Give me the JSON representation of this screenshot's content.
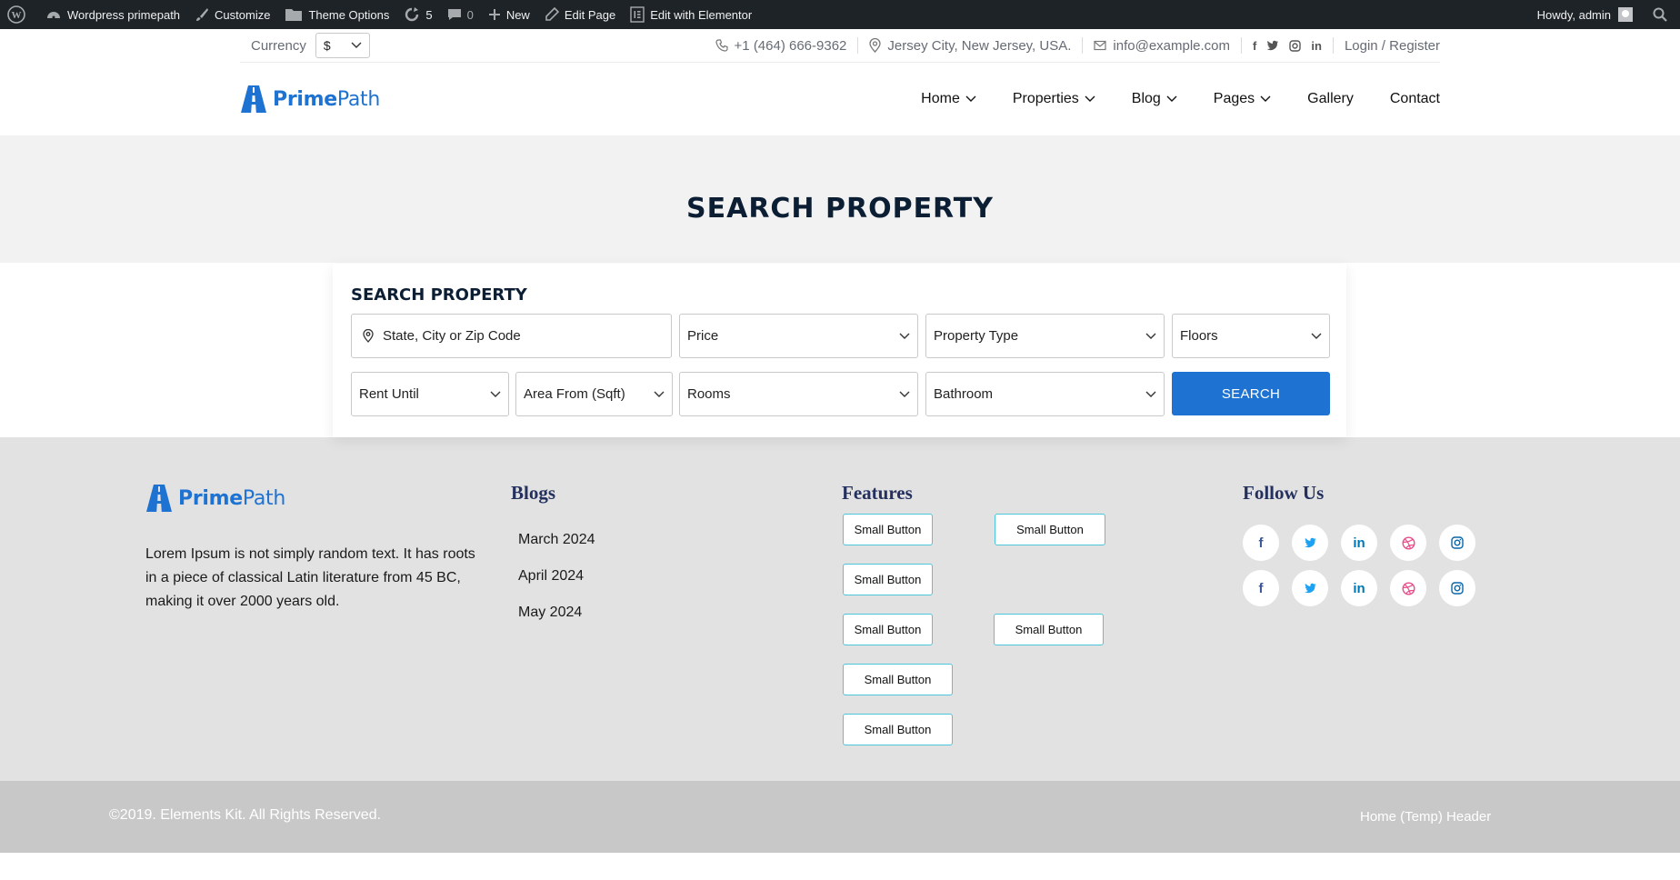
{
  "adminbar": {
    "site_name": "Wordpress primepath",
    "customize": "Customize",
    "theme_options": "Theme Options",
    "updates_count": "5",
    "comments_count": "0",
    "new": "New",
    "edit_page": "Edit Page",
    "edit_elementor": "Edit with Elementor",
    "howdy": "Howdy, admin"
  },
  "topbar": {
    "currency_label": "Currency",
    "currency_value": "$",
    "phone": "+1 (464) 666-9362",
    "location": "Jersey City, New Jersey, USA.",
    "email": "info@example.com",
    "login": "Login / Register"
  },
  "logo": {
    "bold": "Prime",
    "light": "Path"
  },
  "nav": [
    {
      "label": "Home",
      "dropdown": true
    },
    {
      "label": "Properties",
      "dropdown": true
    },
    {
      "label": "Blog",
      "dropdown": true
    },
    {
      "label": "Pages",
      "dropdown": true
    },
    {
      "label": "Gallery",
      "dropdown": false
    },
    {
      "label": "Contact",
      "dropdown": false
    }
  ],
  "banner": {
    "title": "SEARCH PROPERTY"
  },
  "search": {
    "title": "SEARCH PROPERTY",
    "location_placeholder": "State, City or Zip Code",
    "price": "Price",
    "property_type": "Property Type",
    "floors": "Floors",
    "rent_until": "Rent Until",
    "area_from": "Area From (Sqft)",
    "rooms": "Rooms",
    "bathroom": "Bathroom",
    "button": "SEARCH"
  },
  "footer": {
    "about": "Lorem Ipsum is not simply random text. It has roots in a piece of classical Latin literature from 45 BC, making it over 2000 years old.",
    "blogs_heading": "Blogs",
    "blogs": [
      "March 2024",
      "April 2024",
      "May 2024"
    ],
    "features_heading": "Features",
    "small_button": "Small Button",
    "follow_heading": "Follow Us",
    "copyright": "©2019. Elements Kit. All Rights Reserved.",
    "temp_header": "Home (Temp) Header"
  },
  "colors": {
    "brand_blue": "#1e73d2",
    "admin_bar": "#1d2327",
    "footer_bg": "#e2e2e2",
    "bottom_bg": "#c8c8c8",
    "heading_navy": "#24305e",
    "button_border": "#4cc6dc",
    "dribbble_pink": "#ea4c89"
  }
}
